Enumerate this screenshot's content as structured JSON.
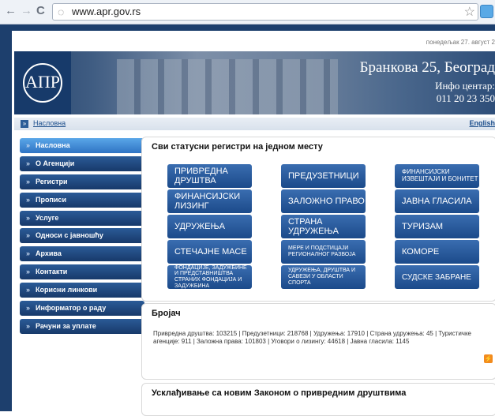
{
  "browser": {
    "back_icon": "back-arrow-icon",
    "forward_icon": "forward-arrow-icon",
    "reload_icon": "reload-icon",
    "url": "www.apr.gov.rs"
  },
  "site": {
    "date": "понедељак 27. август 2",
    "banner": {
      "logo_text": "АПР",
      "address": "Бранкова 25, Београд",
      "info": "Инфо центар:",
      "phone": "011 20 23 350"
    },
    "breadcrumb": {
      "label": "Насловна",
      "english": "English"
    },
    "menu": [
      "Насловна",
      "О Агенцији",
      "Регистри",
      "Прописи",
      "Услуге",
      "Односи с јавношћу",
      "Архива",
      "Контакти",
      "Корисни линкови",
      "Информатор о раду",
      "Рачуни за уплате"
    ],
    "registers": {
      "title": "Сви статусни регистри на једном месту",
      "col1": [
        "ПРИВРЕДНА ДРУШТВА",
        "ФИНАНСИЈСКИ ЛИЗИНГ",
        "УДРУЖЕЊА",
        "СТЕЧАЈНЕ МАСЕ",
        "ФОНДАЦИЈЕ, ЗАДУЖБИНЕ И ПРЕДСТАВНИШТВА СТРАНИХ ФОНДАЦИЈА И ЗАДУЖБИНА"
      ],
      "col2": [
        "ПРЕДУЗЕТНИЦИ",
        "ЗАЛОЖНО ПРАВО",
        "СТРАНА УДРУЖЕЊА",
        "МЕРЕ И ПОДСТИЦАЈИ РЕГИОНАЛНОГ РАЗВОЈА",
        "УДРУЖЕЊА, ДРУШТВА И САВЕЗИ У ОБЛАСТИ СПОРТА"
      ],
      "col3": [
        "ФИНАНСИЈСКИ ИЗВЕШТАЈИ И БОНИТЕТ",
        "ЈАВНА ГЛАСИЛА",
        "ТУРИЗАМ",
        "КОМОРЕ",
        "СУДСКЕ ЗАБРАНЕ"
      ]
    },
    "counter": {
      "title": "Бројач",
      "text": "Привредна друштва: 103215 | Предузетници: 218768 | Удружења: 17910 | Страна удружења: 45 | Туристичке агенције: 911 | Заложна права: 101803 | Уговори о лизингу: 44618 | Јавна гласила: 1145",
      "rss_icon": "rss-icon"
    },
    "news": {
      "title": "Усклађивање са новим Законом о привредним друштвима"
    }
  }
}
